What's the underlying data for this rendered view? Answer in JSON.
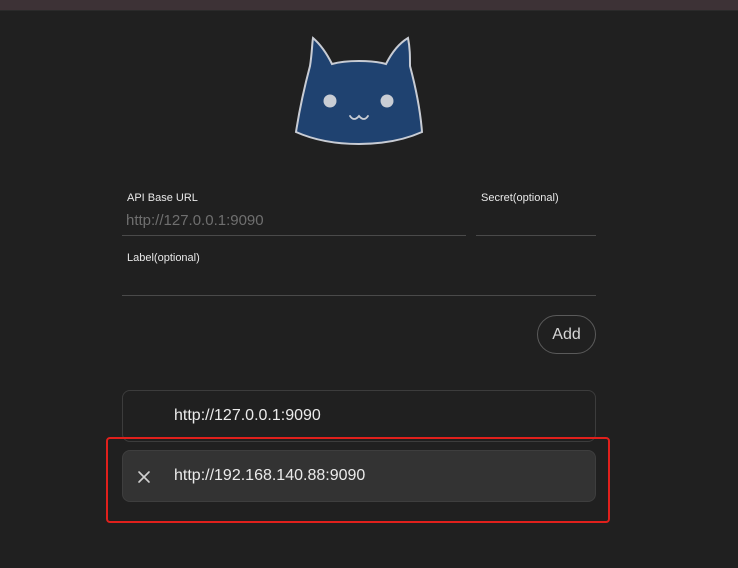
{
  "form": {
    "api_base_url_label": "API Base URL",
    "api_base_url_placeholder": "http://127.0.0.1:9090",
    "api_base_url_value": "",
    "secret_label": "Secret(optional)",
    "secret_value": "",
    "label_label": "Label(optional)",
    "label_value": ""
  },
  "add_button": "Add",
  "servers": [
    {
      "url": "http://127.0.0.1:9090",
      "selected": false
    },
    {
      "url": "http://192.168.140.88:9090",
      "selected": true
    }
  ],
  "colors": {
    "background": "#202020",
    "logo_fill": "#1f4270",
    "highlight": "#e0201c"
  },
  "icons": {
    "logo": "cat-face-icon",
    "remove": "close-icon"
  }
}
